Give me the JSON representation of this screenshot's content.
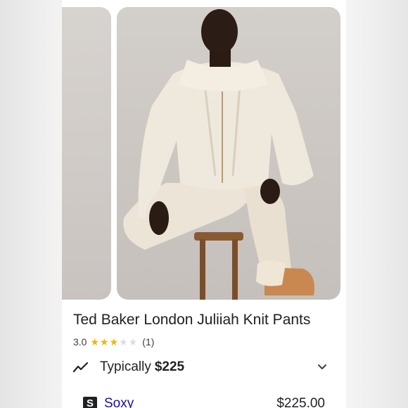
{
  "product": {
    "title": "Ted Baker London Juliiah Knit Pants",
    "rating": "3.0",
    "rating_value": 3,
    "rating_max": 5,
    "review_count": "(1)"
  },
  "pricing": {
    "label": "Typically",
    "price": "$225"
  },
  "seller": {
    "logo_letter": "S",
    "name": "Soxy",
    "price": "$225.00"
  },
  "colors": {
    "star_on": "#f4b400",
    "star_off": "#dadce0",
    "link": "#1a0dab"
  },
  "icons": [
    "trend-line-icon",
    "chevron-down-icon",
    "star-icon"
  ]
}
